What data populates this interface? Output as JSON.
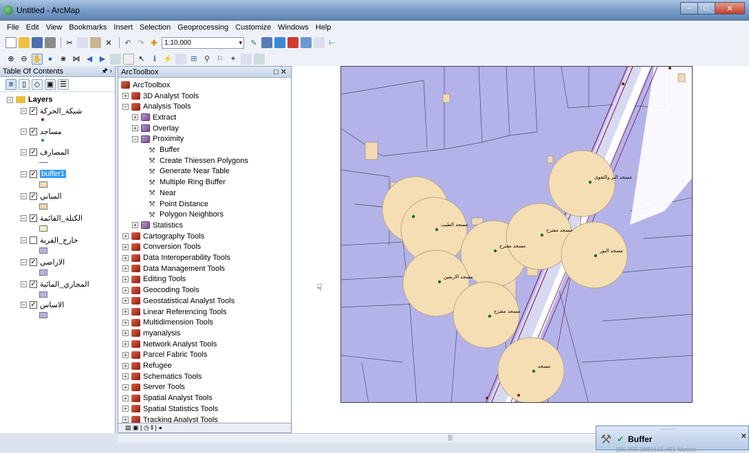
{
  "window": {
    "title": "Untitled - ArcMap"
  },
  "menu": [
    "File",
    "Edit",
    "View",
    "Bookmarks",
    "Insert",
    "Selection",
    "Geoprocessing",
    "Customize",
    "Windows",
    "Help"
  ],
  "toolbar": {
    "scale_value": "1:10,000"
  },
  "toc": {
    "title": "Table Of Contents",
    "root_label": "Layers",
    "layers": [
      {
        "name": "شبكة_الحركة",
        "checked": true,
        "symbol": "dot",
        "color": "#7a1c1c"
      },
      {
        "name": "مساجد",
        "checked": true,
        "symbol": "dot",
        "color": "#2a8a4a"
      },
      {
        "name": "المصارف",
        "checked": true,
        "symbol": "line",
        "color": "#5a5a8a"
      },
      {
        "name": "buffer1",
        "checked": true,
        "selected": true,
        "symbol": "box",
        "color": "#f5deb3"
      },
      {
        "name": "المباني",
        "checked": true,
        "symbol": "box",
        "color": "#f5cfb0"
      },
      {
        "name": "الكتلة_القائمة",
        "checked": true,
        "symbol": "box",
        "color": "#f0f0c8"
      },
      {
        "name": "خارج_القرية",
        "checked": false,
        "symbol": "box",
        "color": "#b3b3ea"
      },
      {
        "name": "الاراضي",
        "checked": true,
        "symbol": "box",
        "color": "#b3b3ea"
      },
      {
        "name": "المجاري_المائية",
        "checked": true,
        "symbol": "box",
        "color": "#b3b3ea"
      },
      {
        "name": "الاساس",
        "checked": true,
        "symbol": "box",
        "color": "#b3b3ea"
      }
    ]
  },
  "arctoolbox": {
    "title": "ArcToolbox",
    "root": "ArcToolbox",
    "items": [
      {
        "label": "3D Analyst Tools",
        "level": 1,
        "type": "toolbox",
        "exp": "+"
      },
      {
        "label": "Analysis Tools",
        "level": 1,
        "type": "toolbox",
        "exp": "−"
      },
      {
        "label": "Extract",
        "level": 2,
        "type": "toolset",
        "exp": "+"
      },
      {
        "label": "Overlay",
        "level": 2,
        "type": "toolset",
        "exp": "+"
      },
      {
        "label": "Proximity",
        "level": 2,
        "type": "toolset",
        "exp": "−"
      },
      {
        "label": "Buffer",
        "level": 3,
        "type": "tool"
      },
      {
        "label": "Create Thiessen Polygons",
        "level": 3,
        "type": "tool"
      },
      {
        "label": "Generate Near Table",
        "level": 3,
        "type": "tool"
      },
      {
        "label": "Multiple Ring Buffer",
        "level": 3,
        "type": "tool"
      },
      {
        "label": "Near",
        "level": 3,
        "type": "tool"
      },
      {
        "label": "Point Distance",
        "level": 3,
        "type": "tool"
      },
      {
        "label": "Polygon Neighbors",
        "level": 3,
        "type": "tool"
      },
      {
        "label": "Statistics",
        "level": 2,
        "type": "toolset",
        "exp": "+"
      },
      {
        "label": "Cartography Tools",
        "level": 1,
        "type": "toolbox",
        "exp": "+"
      },
      {
        "label": "Conversion Tools",
        "level": 1,
        "type": "toolbox",
        "exp": "+"
      },
      {
        "label": "Data Interoperability Tools",
        "level": 1,
        "type": "toolbox",
        "exp": "+"
      },
      {
        "label": "Data Management Tools",
        "level": 1,
        "type": "toolbox",
        "exp": "+"
      },
      {
        "label": "Editing Tools",
        "level": 1,
        "type": "toolbox",
        "exp": "+"
      },
      {
        "label": "Geocoding Tools",
        "level": 1,
        "type": "toolbox",
        "exp": "+"
      },
      {
        "label": "Geostatistical Analyst Tools",
        "level": 1,
        "type": "toolbox",
        "exp": "+"
      },
      {
        "label": "Linear Referencing Tools",
        "level": 1,
        "type": "toolbox",
        "exp": "+"
      },
      {
        "label": "Multidimension Tools",
        "level": 1,
        "type": "toolbox",
        "exp": "+"
      },
      {
        "label": "myanalysis",
        "level": 1,
        "type": "toolbox",
        "exp": "+"
      },
      {
        "label": "Network Analyst Tools",
        "level": 1,
        "type": "toolbox",
        "exp": "+"
      },
      {
        "label": "Parcel Fabric Tools",
        "level": 1,
        "type": "toolbox",
        "exp": "+"
      },
      {
        "label": "Refugee",
        "level": 1,
        "type": "toolbox",
        "exp": "+"
      },
      {
        "label": "Schematics Tools",
        "level": 1,
        "type": "toolbox",
        "exp": "+"
      },
      {
        "label": "Server Tools",
        "level": 1,
        "type": "toolbox",
        "exp": "+"
      },
      {
        "label": "Spatial Analyst Tools",
        "level": 1,
        "type": "toolbox",
        "exp": "+"
      },
      {
        "label": "Spatial Statistics Tools",
        "level": 1,
        "type": "toolbox",
        "exp": "+"
      },
      {
        "label": "Tracking Analyst Tools",
        "level": 1,
        "type": "toolbox",
        "exp": "+"
      }
    ]
  },
  "map": {
    "colors": {
      "background": "#b3b3ea",
      "buffer_fill": "#f5deb3",
      "buffer_edge": "#b9a98a",
      "road": "#8a2b6a",
      "mosque": "#1f6b35"
    },
    "mosque_labels": [
      "مسجد البر والتقوى",
      "مسجد الطيب",
      "مسجد مقترح",
      "مسجد مقترح",
      "مسجد النور",
      "مسجد الاربعين",
      "مسجد مقترح",
      "مسجد"
    ]
  },
  "notification": {
    "tool": "Buffer",
    "coordinates": "155,993  3860141,451 Meters"
  }
}
